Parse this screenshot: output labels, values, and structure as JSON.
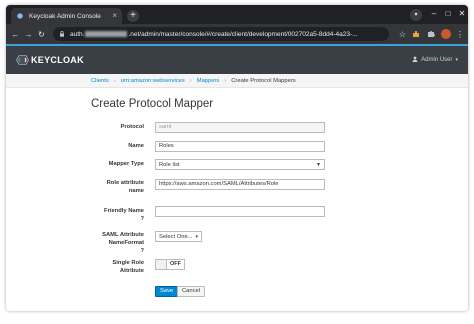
{
  "browser": {
    "tab_title": "Keycloak Admin Console",
    "tab_close": "×",
    "new_tab": "+",
    "url_prefix": "auth.",
    "url_rest": ".net/admin/master/console/#/create/client/development/002702a5-8dd4-4a23-...",
    "nav": {
      "back": "←",
      "forward": "→",
      "reload": "↻"
    },
    "window_controls": {
      "dropdown": "▾",
      "minimize": "–",
      "maximize": "□",
      "close": "✕"
    }
  },
  "header": {
    "logo_text": "KEYCLOAK",
    "user_label": "Admin User",
    "user_caret": "▾"
  },
  "breadcrumb": {
    "items": [
      "Clients",
      "urn:amazon:webservices",
      "Mappers"
    ],
    "current": "Create Protocol Mappers",
    "separator": "›"
  },
  "page_title": "Create Protocol Mapper",
  "form": {
    "protocol": {
      "label": "Protocol",
      "value": "saml"
    },
    "name": {
      "label": "Name",
      "value": "Roles"
    },
    "mapper_type": {
      "label": "Mapper Type",
      "value": "Role list"
    },
    "role_attribute_name": {
      "label_line1": "Role attribute",
      "label_line2": "name",
      "value": "https://aws.amazon.com/SAML/Attributes/Role"
    },
    "friendly_name": {
      "label": "Friendly Name",
      "value": ""
    },
    "saml_attribute_nameformat": {
      "label_line1": "SAML Attribute",
      "label_line2": "NameFormat",
      "value": "Select One..."
    },
    "single_role_attribute": {
      "label_line1": "Single Role",
      "label_line2": "Attribute",
      "value": "OFF"
    },
    "help_glyph": "?",
    "save_label": "Save",
    "cancel_label": "Cancel"
  },
  "colors": {
    "brand_blue": "#0088ce",
    "header_bg": "#393f44",
    "chrome_dark": "#202124"
  }
}
